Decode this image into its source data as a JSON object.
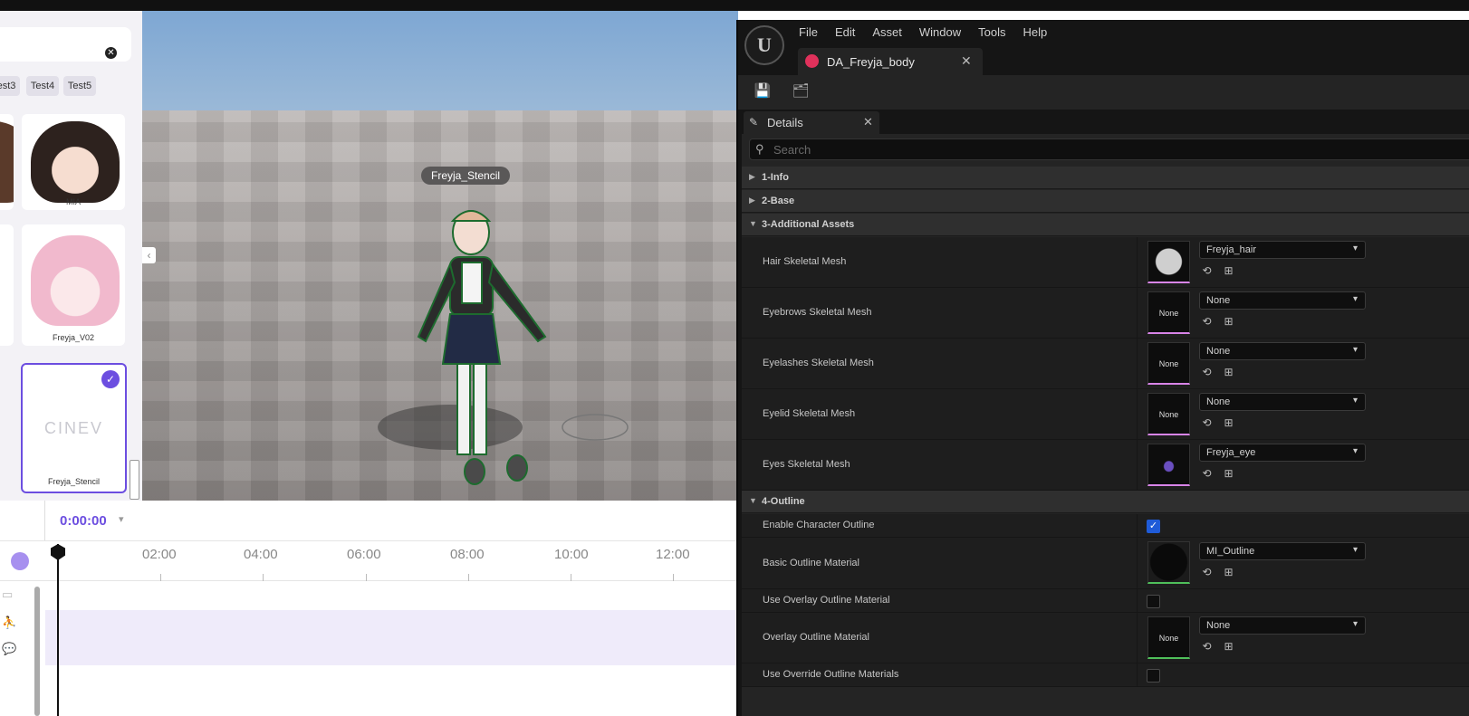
{
  "left_panel": {
    "tags": [
      "est3",
      "Test4",
      "Test5"
    ],
    "cards": [
      "MIA",
      "Freyja_V02",
      "Freyja_Stencil"
    ],
    "stencil_logo": "CINEV"
  },
  "viewport": {
    "character_label": "Freyja_Stencil"
  },
  "timeline": {
    "time": "0:00:00",
    "ticks": [
      "02:00",
      "04:00",
      "06:00",
      "08:00",
      "10:00",
      "12:00"
    ]
  },
  "ue": {
    "logo": "U",
    "menu": [
      "File",
      "Edit",
      "Asset",
      "Window",
      "Tools",
      "Help"
    ],
    "tab_title": "DA_Freyja_body",
    "details_title": "Details",
    "search_placeholder": "Search",
    "categories": {
      "c1": "1-Info",
      "c2": "2-Base",
      "c3": "3-Additional Assets",
      "c4": "4-Outline"
    },
    "props": {
      "hair": {
        "label": "Hair Skeletal Mesh",
        "value": "Freyja_hair"
      },
      "eyebrows": {
        "label": "Eyebrows Skeletal Mesh",
        "value": "None",
        "thumb": "None"
      },
      "eyelashes": {
        "label": "Eyelashes Skeletal Mesh",
        "value": "None",
        "thumb": "None"
      },
      "eyelid": {
        "label": "Eyelid Skeletal Mesh",
        "value": "None",
        "thumb": "None"
      },
      "eyes": {
        "label": "Eyes Skeletal Mesh",
        "value": "Freyja_eye"
      },
      "enable_outline": {
        "label": "Enable Character Outline",
        "checked": true
      },
      "basic_outline": {
        "label": "Basic Outline Material",
        "value": "MI_Outline"
      },
      "use_overlay": {
        "label": "Use Overlay Outline Material",
        "checked": false
      },
      "overlay_outline": {
        "label": "Overlay Outline Material",
        "value": "None",
        "thumb": "None"
      },
      "use_override": {
        "label": "Use Override Outline Materials",
        "checked": false
      }
    }
  }
}
